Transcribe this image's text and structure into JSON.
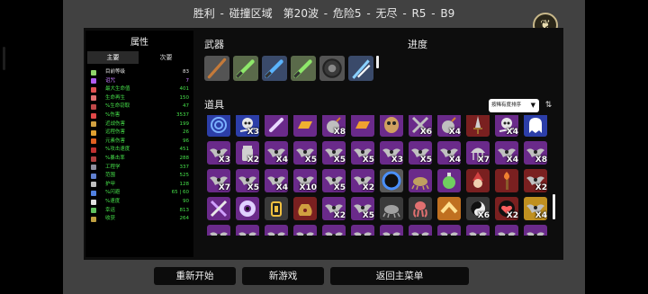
{
  "header": {
    "title": "胜利 - 碰撞区域　第20波 - 危险5 - 无尽 - R5 - B9",
    "emblem_icon": "laurel-emblem-icon"
  },
  "stats_panel": {
    "title": "属性",
    "tabs": [
      {
        "label": "主要",
        "active": true
      },
      {
        "label": "次要",
        "active": false
      }
    ],
    "rows": [
      {
        "name": "目前等级",
        "value": "83",
        "color": "#e6e6e6",
        "icon_color": "#8fd46a"
      },
      {
        "name": "诅咒",
        "value": "7",
        "color": "#c77dff",
        "icon_color": "#b05cf0"
      },
      {
        "name": "最大生命值",
        "value": "401",
        "color": "#46e04a",
        "icon_color": "#e05050"
      },
      {
        "name": "生命再生",
        "value": "150",
        "color": "#46e04a",
        "icon_color": "#e07070"
      },
      {
        "name": "%生命窃取",
        "value": "47",
        "color": "#46e04a",
        "icon_color": "#c04848"
      },
      {
        "name": "%伤害",
        "value": "3537",
        "color": "#46e04a",
        "icon_color": "#e04848"
      },
      {
        "name": "近战伤害",
        "value": "199",
        "color": "#46e04a",
        "icon_color": "#d0a040"
      },
      {
        "name": "远程伤害",
        "value": "26",
        "color": "#46e04a",
        "icon_color": "#e0a030"
      },
      {
        "name": "元素伤害",
        "value": "96",
        "color": "#46e04a",
        "icon_color": "#e06020"
      },
      {
        "name": "%攻击速度",
        "value": "451",
        "color": "#46e04a",
        "icon_color": "#c03030"
      },
      {
        "name": "%暴击率",
        "value": "288",
        "color": "#46e04a",
        "icon_color": "#b04040"
      },
      {
        "name": "工程学",
        "value": "337",
        "color": "#46e04a",
        "icon_color": "#9090a0"
      },
      {
        "name": "范围",
        "value": "525",
        "color": "#46e04a",
        "icon_color": "#6080d0"
      },
      {
        "name": "护甲",
        "value": "128",
        "color": "#46e04a",
        "icon_color": "#c0c0c0"
      },
      {
        "name": "%闪避",
        "value": "65 | 60",
        "color": "#46e04a",
        "icon_color": "#5080e0"
      },
      {
        "name": "%速度",
        "value": "90",
        "color": "#46e04a",
        "icon_color": "#e0e0e0"
      },
      {
        "name": "幸运",
        "value": "813",
        "color": "#46e04a",
        "icon_color": "#60c060"
      },
      {
        "name": "收获",
        "value": "264",
        "color": "#46e04a",
        "icon_color": "#c0a040"
      }
    ]
  },
  "weapons": {
    "title": "武器",
    "slots": [
      {
        "icon": "staff-icon",
        "bg": "#545454",
        "fg": "#c47a3a"
      },
      {
        "icon": "green-sword-icon",
        "bg": "#5a6a4a",
        "fg": "#8ee86a"
      },
      {
        "icon": "blue-sword-icon",
        "bg": "#3a4a6a",
        "fg": "#5ab4ff"
      },
      {
        "icon": "green-sword-icon",
        "bg": "#5a6a4a",
        "fg": "#8ee86a"
      },
      {
        "icon": "shield-ring-icon",
        "bg": "#545454",
        "fg": "#3a3a3a"
      },
      {
        "icon": "ice-shard-icon",
        "bg": "#3a4a6a",
        "fg": "#8ad0ff"
      }
    ]
  },
  "progress": {
    "title": "进度"
  },
  "items": {
    "title": "道具",
    "sort_label": "按稀有度排序",
    "sort_toggle_icon": "sort-order-icon",
    "rows": [
      [
        {
          "icon": "spiral-icon",
          "bg": "#2c3ea8",
          "fg": "#7ab0ff",
          "count": ""
        },
        {
          "icon": "skull-crossbones-icon",
          "bg": "#2c3ea8",
          "fg": "#e8e8e8",
          "count": "X3"
        },
        {
          "icon": "bone-icon",
          "bg": "#6a2a8a",
          "fg": "#e8d8ff",
          "count": ""
        },
        {
          "icon": "gold-bar-icon",
          "bg": "#6a2a8a",
          "fg": "#f0b030",
          "count": ""
        },
        {
          "icon": "bomb-icon",
          "bg": "#6a2a8a",
          "fg": "#bfbfbf",
          "count": "X8"
        },
        {
          "icon": "gold-bar-icon",
          "bg": "#6a2a8a",
          "fg": "#f0a030",
          "count": ""
        },
        {
          "icon": "mask-icon",
          "bg": "#6a2a8a",
          "fg": "#d0a060",
          "count": ""
        },
        {
          "icon": "crossed-swords-icon",
          "bg": "#6a2a8a",
          "fg": "#c0c0c0",
          "count": "X6"
        },
        {
          "icon": "bomb-icon",
          "bg": "#6a2a8a",
          "fg": "#bfbfbf",
          "count": "X4"
        },
        {
          "icon": "dagger-icon",
          "bg": "#7a2020",
          "fg": "#d0d0d0",
          "count": ""
        },
        {
          "icon": "skull-crossbones-icon",
          "bg": "#6a2a8a",
          "fg": "#e8e8e8",
          "count": "X4"
        },
        {
          "icon": "ghost-icon",
          "bg": "#2c3ea8",
          "fg": "#ffffff",
          "count": ""
        }
      ],
      [
        {
          "icon": "bat-icon",
          "bg": "#6a2a8a",
          "fg": "#c0c0c0",
          "count": "X3"
        },
        {
          "icon": "jar-icon",
          "bg": "#6a2a8a",
          "fg": "#d0d0d0",
          "count": "X2"
        },
        {
          "icon": "bat-icon",
          "bg": "#6a2a8a",
          "fg": "#c0c0c0",
          "count": "X4"
        },
        {
          "icon": "bat-icon",
          "bg": "#6a2a8a",
          "fg": "#c0c0c0",
          "count": "X5"
        },
        {
          "icon": "bat-icon",
          "bg": "#6a2a8a",
          "fg": "#c0c0c0",
          "count": "X5"
        },
        {
          "icon": "bat-icon",
          "bg": "#6a2a8a",
          "fg": "#c0c0c0",
          "count": "X5"
        },
        {
          "icon": "bat-icon",
          "bg": "#6a2a8a",
          "fg": "#c0c0c0",
          "count": "X3"
        },
        {
          "icon": "bat-icon",
          "bg": "#6a2a8a",
          "fg": "#c0c0c0",
          "count": "X5"
        },
        {
          "icon": "bat-icon",
          "bg": "#6a2a8a",
          "fg": "#c0c0c0",
          "count": "X4"
        },
        {
          "icon": "jellyfish-icon",
          "bg": "#6a2a8a",
          "fg": "#d0d0d0",
          "count": "X7"
        },
        {
          "icon": "bat-icon",
          "bg": "#6a2a8a",
          "fg": "#c0c0c0",
          "count": "X4"
        },
        {
          "icon": "bat-icon",
          "bg": "#6a2a8a",
          "fg": "#c0c0c0",
          "count": "X8"
        }
      ],
      [
        {
          "icon": "bat-icon",
          "bg": "#6a2a8a",
          "fg": "#c0c0c0",
          "count": "X7"
        },
        {
          "icon": "bat-icon",
          "bg": "#6a2a8a",
          "fg": "#c0c0c0",
          "count": "X5"
        },
        {
          "icon": "bat-icon",
          "bg": "#6a2a8a",
          "fg": "#c0c0c0",
          "count": "X4"
        },
        {
          "icon": "bat-icon",
          "bg": "#6a2a8a",
          "fg": "#c0c0c0",
          "count": "X10"
        },
        {
          "icon": "bat-icon",
          "bg": "#6a2a8a",
          "fg": "#c0c0c0",
          "count": "X5"
        },
        {
          "icon": "bat-icon",
          "bg": "#6a2a8a",
          "fg": "#c0c0c0",
          "count": "X2"
        },
        {
          "icon": "portal-icon",
          "bg": "#5a5a5a",
          "fg": "#4a90ff",
          "count": ""
        },
        {
          "icon": "crawler-icon",
          "bg": "#6a2a8a",
          "fg": "#c0a060",
          "count": ""
        },
        {
          "icon": "potion-icon",
          "bg": "#6a2a8a",
          "fg": "#70d060",
          "count": ""
        },
        {
          "icon": "gnome-icon",
          "bg": "#7a2020",
          "fg": "#d04040",
          "count": ""
        },
        {
          "icon": "torch-icon",
          "bg": "#7a2020",
          "fg": "#f08030",
          "count": ""
        },
        {
          "icon": "bat-icon",
          "bg": "#7a2020",
          "fg": "#c0c0c0",
          "count": "X2"
        }
      ],
      [
        {
          "icon": "crossed-tools-icon",
          "bg": "#6a2a8a",
          "fg": "#d0a0ff",
          "count": ""
        },
        {
          "icon": "eye-orb-icon",
          "bg": "#6a2a8a",
          "fg": "#e0d0ff",
          "count": ""
        },
        {
          "icon": "lantern-icon",
          "bg": "#3a3a3a",
          "fg": "#f0c040",
          "count": ""
        },
        {
          "icon": "coin-bag-icon",
          "bg": "#7a2020",
          "fg": "#d0a040",
          "count": ""
        },
        {
          "icon": "bat-icon",
          "bg": "#6a2a8a",
          "fg": "#c0c0c0",
          "count": "X2"
        },
        {
          "icon": "bat-icon",
          "bg": "#6a2a8a",
          "fg": "#c0c0c0",
          "count": "X5"
        },
        {
          "icon": "crawler-icon",
          "bg": "#3a3a3a",
          "fg": "#a0a0a0",
          "count": ""
        },
        {
          "icon": "octopus-icon",
          "bg": "#3a3a3a",
          "fg": "#e07070",
          "count": ""
        },
        {
          "icon": "chevron-up-icon",
          "bg": "#c07020",
          "fg": "#ffe090",
          "count": ""
        },
        {
          "icon": "yin-yang-icon",
          "bg": "#3a3a3a",
          "fg": "#f0f0f0",
          "count": "X6"
        },
        {
          "icon": "heart-target-icon",
          "bg": "#7a2020",
          "fg": "#ff6060",
          "count": "X2"
        },
        {
          "icon": "bat-icon",
          "bg": "#c09020",
          "fg": "#c0c0c0",
          "count": "X4"
        }
      ],
      [
        {
          "icon": "bat-icon",
          "bg": "#6a2a8a",
          "fg": "#c0c0c0",
          "count": ""
        },
        {
          "icon": "bat-icon",
          "bg": "#6a2a8a",
          "fg": "#c0c0c0",
          "count": ""
        },
        {
          "icon": "bat-icon",
          "bg": "#6a2a8a",
          "fg": "#c0c0c0",
          "count": ""
        },
        {
          "icon": "bat-icon",
          "bg": "#6a2a8a",
          "fg": "#c0c0c0",
          "count": ""
        },
        {
          "icon": "bat-icon",
          "bg": "#6a2a8a",
          "fg": "#c0c0c0",
          "count": ""
        },
        {
          "icon": "bat-icon",
          "bg": "#6a2a8a",
          "fg": "#c0c0c0",
          "count": ""
        },
        {
          "icon": "bat-icon",
          "bg": "#6a2a8a",
          "fg": "#c0c0c0",
          "count": ""
        },
        {
          "icon": "bat-icon",
          "bg": "#6a2a8a",
          "fg": "#c0c0c0",
          "count": ""
        },
        {
          "icon": "bat-icon",
          "bg": "#6a2a8a",
          "fg": "#c0c0c0",
          "count": ""
        },
        {
          "icon": "bat-icon",
          "bg": "#6a2a8a",
          "fg": "#c0c0c0",
          "count": ""
        },
        {
          "icon": "bat-icon",
          "bg": "#6a2a8a",
          "fg": "#c0c0c0",
          "count": ""
        },
        {
          "icon": "bat-icon",
          "bg": "#6a2a8a",
          "fg": "#c0c0c0",
          "count": ""
        }
      ]
    ]
  },
  "buttons": {
    "restart": "重新开始",
    "new_game": "新游戏",
    "back_main_menu": "返回主菜单"
  }
}
